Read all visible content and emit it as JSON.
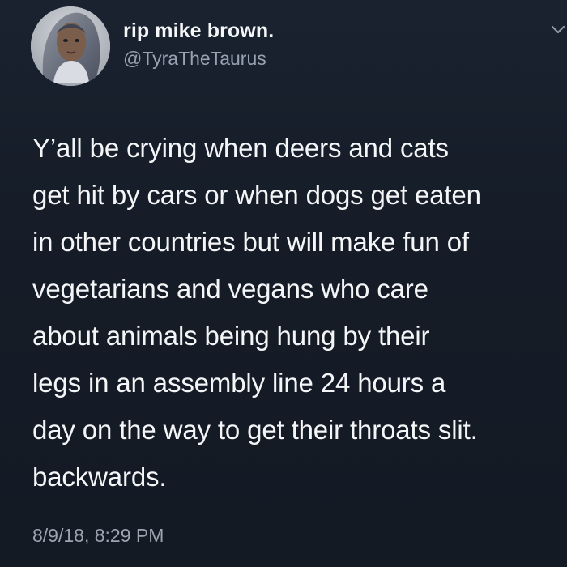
{
  "tweet": {
    "display_name": "rip mike brown.",
    "handle": "@TyraTheTaurus",
    "text": "Y’all be crying when deers and cats\nget hit by cars or when dogs get eaten\nin other countries but will make fun of\nvegetarians and vegans who care\nabout animals being hung by their\nlegs in an assembly line 24 hours a\nday on the way to get their throats slit.\nbackwards.",
    "timestamp": "8/9/18, 8:29 PM",
    "avatar_icon": "profile-avatar",
    "menu_icon": "chevron-down-icon"
  },
  "colors": {
    "background": "#151c27",
    "primary_text": "#f4f5f7",
    "secondary_text": "#98a3b1"
  }
}
